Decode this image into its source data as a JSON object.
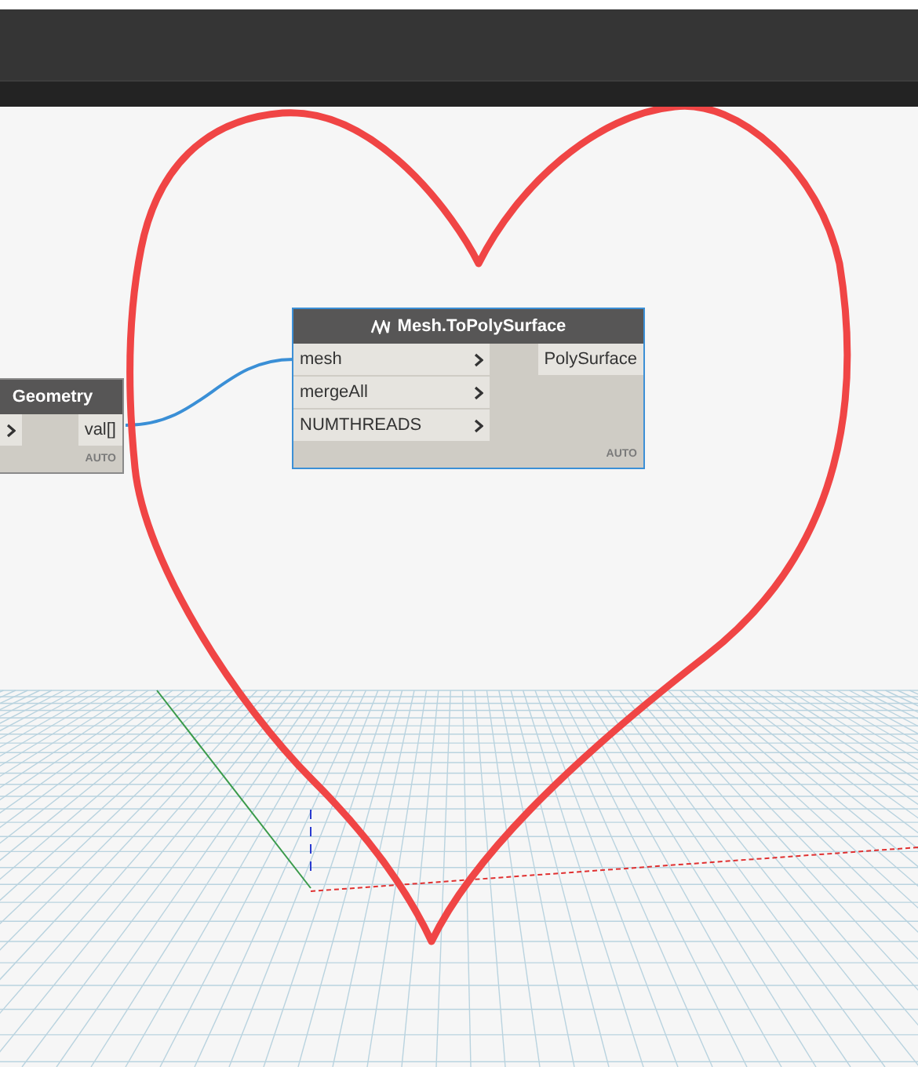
{
  "nodes": [
    {
      "title": "Geometry",
      "selected": false,
      "lacing": false,
      "unlabeled_input": true,
      "outputs": [
        "val[]"
      ],
      "footer": "AUTO"
    },
    {
      "title": "Mesh.ToPolySurface",
      "selected": true,
      "lacing": true,
      "inputs": [
        {
          "label": "mesh"
        },
        {
          "label": "mergeAll"
        },
        {
          "label": "NUMTHREADS"
        }
      ],
      "outputs": [
        "PolySurface"
      ],
      "footer": "AUTO"
    }
  ]
}
